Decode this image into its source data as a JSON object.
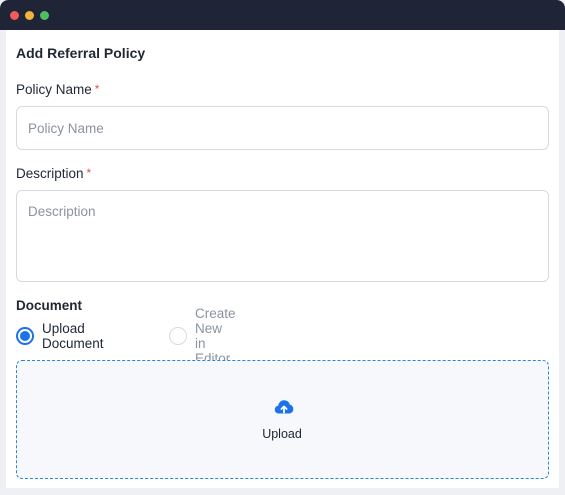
{
  "form": {
    "title": "Add Referral Policy",
    "policy_name": {
      "label": "Policy Name",
      "required_mark": "*",
      "placeholder": "Policy Name",
      "value": ""
    },
    "description": {
      "label": "Description",
      "required_mark": "*",
      "placeholder": "Description",
      "value": ""
    },
    "document": {
      "label": "Document",
      "options": [
        {
          "label": "Upload Document",
          "selected": true
        },
        {
          "label": "Create New in Editor",
          "selected": false
        }
      ],
      "upload": {
        "label": "Upload",
        "icon": "cloud-upload-icon"
      }
    }
  },
  "colors": {
    "accent": "#1a73e8",
    "required": "#e0505a",
    "titlebar": "#1f2537"
  }
}
